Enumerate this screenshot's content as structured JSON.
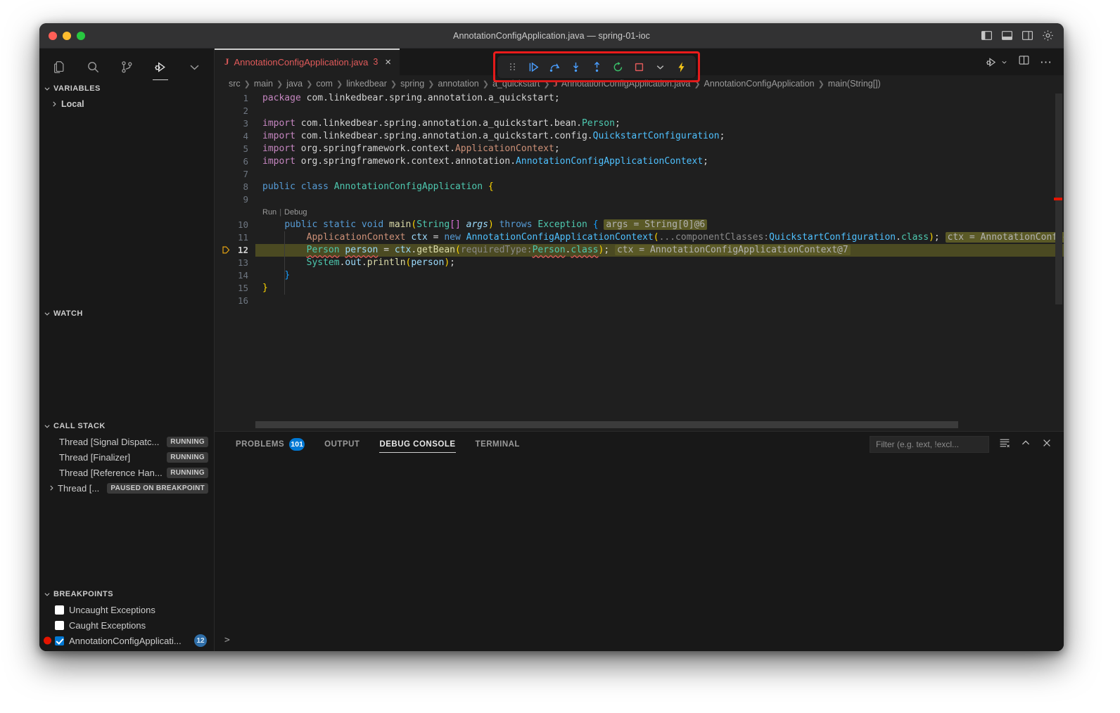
{
  "window": {
    "title": "AnnotationConfigApplication.java — spring-01-ioc",
    "traffic": {
      "close": "close",
      "minimize": "minimize",
      "zoom": "zoom"
    },
    "layout_controls": [
      "toggle-primary-sidebar",
      "toggle-panel",
      "toggle-secondary-sidebar",
      "settings-gear"
    ]
  },
  "activity_bar": {
    "items": [
      {
        "name": "explorer",
        "icon": "files-icon",
        "active": false
      },
      {
        "name": "search",
        "icon": "search-icon",
        "active": false
      },
      {
        "name": "source-control",
        "icon": "source-control-icon",
        "active": false
      },
      {
        "name": "run-and-debug",
        "icon": "run-debug-icon",
        "active": true
      },
      {
        "name": "more",
        "icon": "chevron-down-icon",
        "active": false
      }
    ]
  },
  "sidebar": {
    "variables": {
      "title": "Variables",
      "items": [
        {
          "label": "Local",
          "expanded": false
        }
      ]
    },
    "watch": {
      "title": "Watch",
      "items": []
    },
    "call_stack": {
      "title": "Call Stack",
      "threads": [
        {
          "label": "Thread [Signal Dispatc...",
          "state": "RUNNING",
          "expandable": false
        },
        {
          "label": "Thread [Finalizer]",
          "state": "RUNNING",
          "expandable": false
        },
        {
          "label": "Thread [Reference Han...",
          "state": "RUNNING",
          "expandable": false
        },
        {
          "label": "Thread [...",
          "state": "PAUSED ON BREAKPOINT",
          "expandable": true
        }
      ]
    },
    "breakpoints": {
      "title": "Breakpoints",
      "items": [
        {
          "label": "Uncaught Exceptions",
          "checked": false,
          "has_dot": false,
          "count": ""
        },
        {
          "label": "Caught Exceptions",
          "checked": false,
          "has_dot": false,
          "count": ""
        },
        {
          "label": "AnnotationConfigApplicati...",
          "checked": true,
          "has_dot": true,
          "count": "12"
        }
      ]
    }
  },
  "editor": {
    "tab": {
      "file_icon": "J",
      "filename": "AnnotationConfigApplication.java",
      "problem_count": "3",
      "close": "×"
    },
    "tab_actions": [
      "run-debug-dropdown-icon",
      "split-editor-icon",
      "more-actions-icon"
    ],
    "breadcrumbs": [
      "src",
      "main",
      "java",
      "com",
      "linkedbear",
      "spring",
      "annotation",
      "a_quickstart",
      "AnnotationConfigApplication.java",
      "AnnotationConfigApplication",
      "main(String[])"
    ],
    "codelens": {
      "run": "Run",
      "separator": "|",
      "debug": "Debug"
    },
    "current_line": 12,
    "lines": [
      {
        "n": 1,
        "text": "package com.linkedbear.spring.annotation.a_quickstart;"
      },
      {
        "n": 2,
        "text": ""
      },
      {
        "n": 3,
        "text": "import com.linkedbear.spring.annotation.a_quickstart.bean.Person;"
      },
      {
        "n": 4,
        "text": "import com.linkedbear.spring.annotation.a_quickstart.config.QuickstartConfiguration;"
      },
      {
        "n": 5,
        "text": "import org.springframework.context.ApplicationContext;"
      },
      {
        "n": 6,
        "text": "import org.springframework.context.annotation.AnnotationConfigApplicationContext;"
      },
      {
        "n": 7,
        "text": ""
      },
      {
        "n": 8,
        "text": "public class AnnotationConfigApplication {"
      },
      {
        "n": 9,
        "text": ""
      },
      {
        "n": 10,
        "text": "    public static void main(String[] args) throws Exception {"
      },
      {
        "n": 11,
        "text": "        ApplicationContext ctx = new AnnotationConfigApplicationContext(...componentClasses:QuickstartConfiguration.class);"
      },
      {
        "n": 12,
        "text": "        Person person = ctx.getBean(requiredType:Person.class);"
      },
      {
        "n": 13,
        "text": "        System.out.println(person);"
      },
      {
        "n": 14,
        "text": "    }"
      },
      {
        "n": 15,
        "text": "}"
      },
      {
        "n": 16,
        "text": ""
      }
    ],
    "inline_values": {
      "line10": "args = String[0]@6",
      "line11": "ctx = AnnotationConfigApplicationCont",
      "line12": "ctx = AnnotationConfigApplicationContext@7"
    }
  },
  "debug_toolbar": {
    "buttons": [
      {
        "name": "drag-handle",
        "icon": "grip-icon"
      },
      {
        "name": "continue",
        "icon": "continue-icon",
        "color": "#4a9eff"
      },
      {
        "name": "step-over",
        "icon": "step-over-icon",
        "color": "#4a9eff"
      },
      {
        "name": "step-into",
        "icon": "step-into-icon",
        "color": "#4a9eff"
      },
      {
        "name": "step-out",
        "icon": "step-out-icon",
        "color": "#4a9eff"
      },
      {
        "name": "restart",
        "icon": "restart-icon",
        "color": "#3ac06a"
      },
      {
        "name": "stop",
        "icon": "stop-icon",
        "color": "#e05a5a"
      },
      {
        "name": "session-dropdown",
        "icon": "chevron-down-icon",
        "color": "#b8b8b8"
      },
      {
        "name": "hot-reload",
        "icon": "lightning-icon",
        "color": "#f5c518"
      }
    ],
    "highlight_color": "#ee1c1c"
  },
  "panel": {
    "tabs": [
      {
        "label": "Problems",
        "badge": "101",
        "active": false
      },
      {
        "label": "Output",
        "badge": "",
        "active": false
      },
      {
        "label": "Debug Console",
        "badge": "",
        "active": true
      },
      {
        "label": "Terminal",
        "badge": "",
        "active": false
      }
    ],
    "filter_placeholder": "Filter (e.g. text, !excl...",
    "actions": [
      "clear-console-icon",
      "maximize-panel-icon",
      "close-panel-icon"
    ],
    "repl_prompt": ">"
  },
  "colors": {
    "accent": "#0078d4",
    "breakpoint_red": "#e51400",
    "highlight_line": "#4b4a22",
    "editor_bg": "#1f1f1f",
    "sidebar_bg": "#181818",
    "titlebar_bg": "#323233"
  }
}
